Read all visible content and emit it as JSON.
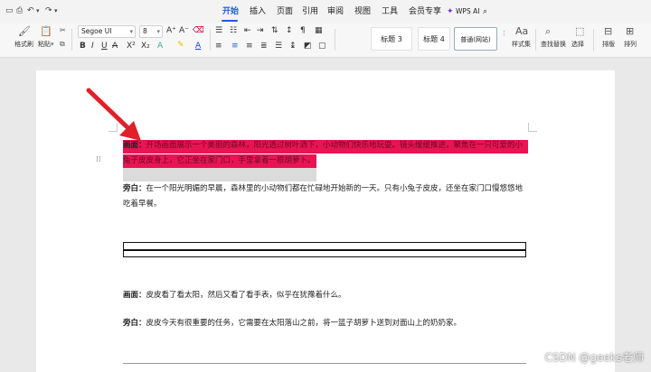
{
  "menubar": {
    "tabs": [
      "开始",
      "插入",
      "页面",
      "引用",
      "审阅",
      "视图",
      "工具",
      "会员专享"
    ],
    "active_tab": "开始",
    "wps_ai": "WPS AI"
  },
  "ribbon": {
    "format_painter": "格式刷",
    "paste": "粘贴",
    "font_name": "Segoe UI",
    "font_size": "8",
    "style_heading3": "标题 3",
    "style_heading4": "标题 4",
    "style_body": "普通(网站)",
    "styles_set": "样式集",
    "find_replace": "查找替换",
    "select": "选择",
    "layout": "排版",
    "sort": "排列"
  },
  "document": {
    "p1_label": "画面：",
    "p1_text": "开场画面展示一个美丽的森林，阳光透过树叶洒下，小动物们快乐地玩耍。镜头缓缓推进，聚焦在一只可爱的小兔子皮皮身上，它正坐在家门口，手里拿着一根胡萝卜。",
    "p2_label": "旁白：",
    "p2_text": "在一个阳光明媚的早晨，森林里的小动物们都在忙碌地开始新的一天。只有小兔子皮皮，还坐在家门口慢悠悠地吃着早餐。",
    "p3_label": "画面：",
    "p3_text": "皮皮看了看太阳，然后又看了看手表，似乎在犹豫着什么。",
    "p4_label": "旁白：",
    "p4_text": "皮皮今天有很重要的任务，它需要在太阳落山之前，将一篮子胡萝卜送到对面山上的奶奶家。"
  },
  "watermark": "CSDN @geeks老师",
  "colors": {
    "accent": "#1a5fd6",
    "highlight": "#e81454",
    "arrow": "#e0202a"
  }
}
